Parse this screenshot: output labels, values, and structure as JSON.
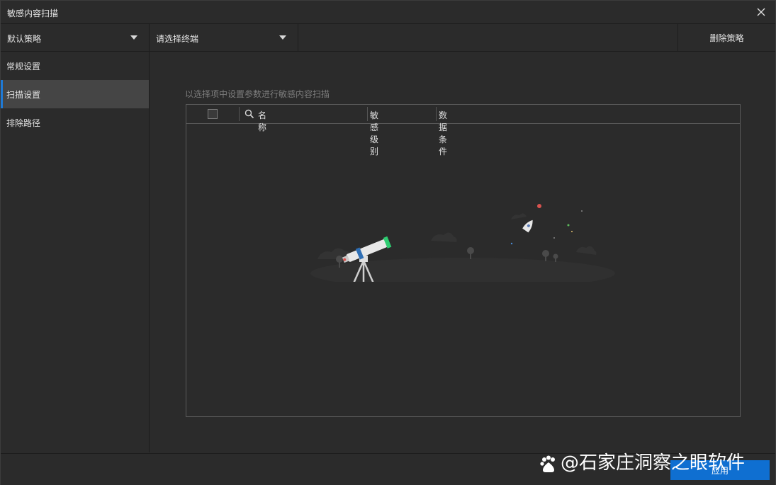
{
  "window": {
    "title": "敏感内容扫描"
  },
  "toolbar": {
    "policy_dropdown": "默认策略",
    "terminal_dropdown": "请选择终端",
    "delete_label": "删除策略"
  },
  "sidebar": {
    "items": [
      {
        "label": "常规设置",
        "active": false
      },
      {
        "label": "扫描设置",
        "active": true
      },
      {
        "label": "排除路径",
        "active": false
      }
    ]
  },
  "main": {
    "hint": "以选择项中设置参数进行敏感内容扫描",
    "table": {
      "columns": [
        "名称",
        "敏感级别",
        "数据条件"
      ],
      "rows": []
    }
  },
  "footer": {
    "apply_label": "应用"
  },
  "watermark": {
    "text": "@石家庄洞察之眼软件"
  },
  "colors": {
    "accent": "#0f6fd1",
    "active_indicator": "#1f7ad6",
    "background": "#2b2b2b"
  },
  "icons": {
    "close": "close-icon",
    "dropdown": "caret-down-icon",
    "search": "search-icon",
    "empty_state": "telescope-illustration"
  }
}
